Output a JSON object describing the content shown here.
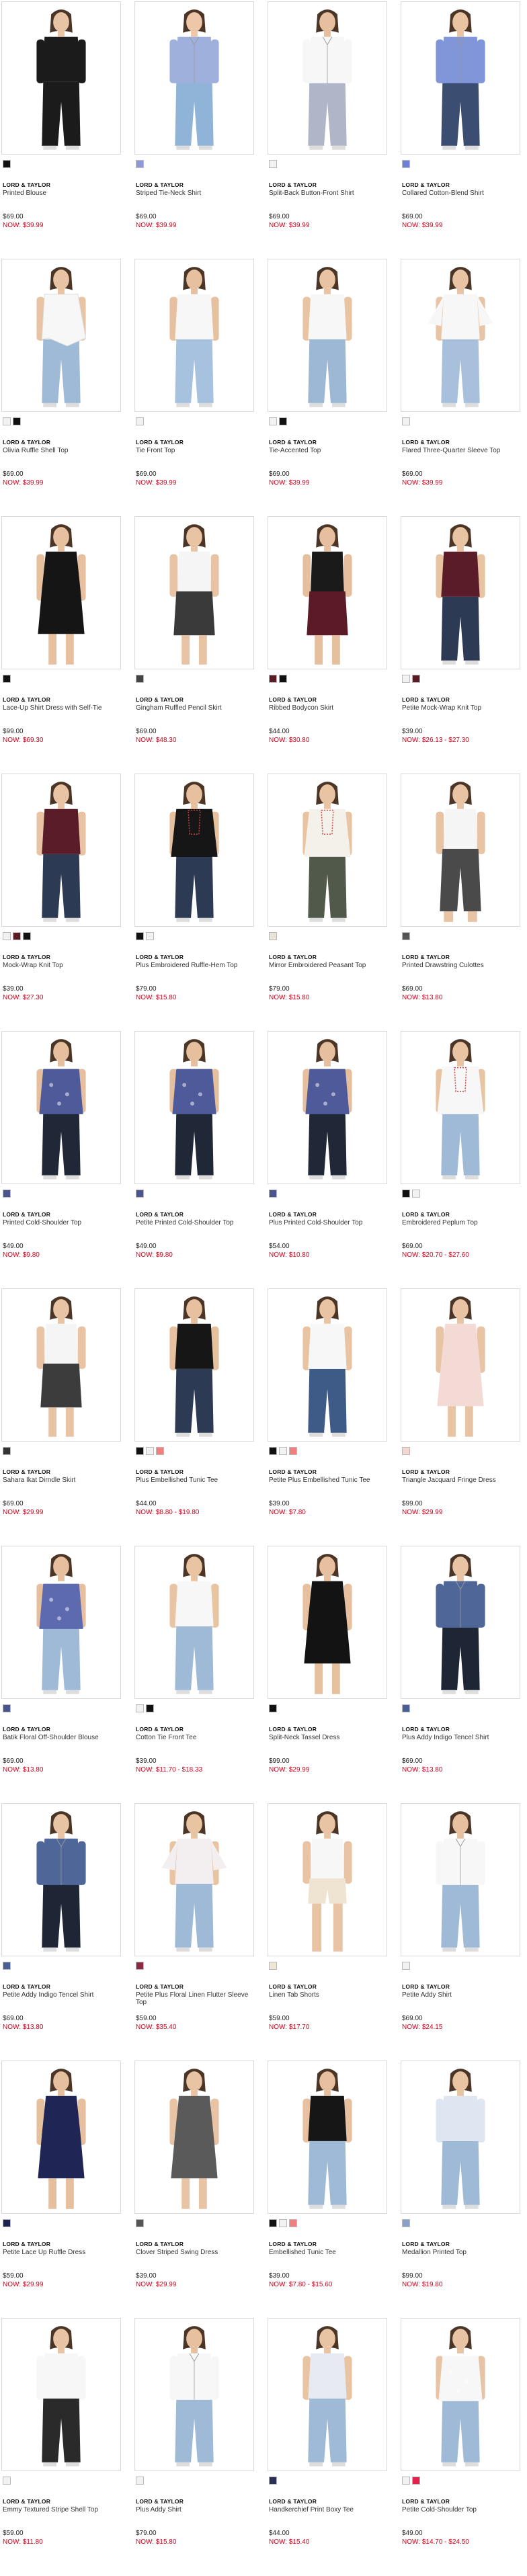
{
  "products": [
    {
      "brand": "LORD & TAYLOR",
      "name": "Printed Blouse",
      "price": "$69.00",
      "sale": "NOW: $39.99",
      "swatches": [
        "#111111"
      ],
      "top": "#1b1b1b",
      "bottom": "#1b1b1b",
      "skin": "#e8c3a4",
      "style": "blouse"
    },
    {
      "brand": "LORD & TAYLOR",
      "name": "Striped Tie-Neck Shirt",
      "price": "$69.00",
      "sale": "NOW: $39.99",
      "swatches": [
        "#8e9ad8"
      ],
      "top": "#9fb0dc",
      "bottom": "#8fb4d8",
      "skin": "#edc7a8",
      "style": "shirt"
    },
    {
      "brand": "LORD & TAYLOR",
      "name": "Split-Back Button-Front Shirt",
      "price": "$69.00",
      "sale": "NOW: $39.99",
      "swatches": [
        "#f2f2f2"
      ],
      "top": "#f7f7f7",
      "bottom": "#aeb6c8",
      "skin": "#e5bf9e",
      "style": "shirt"
    },
    {
      "brand": "LORD & TAYLOR",
      "name": "Collared Cotton-Blend Shirt",
      "price": "$69.00",
      "sale": "NOW: $39.99",
      "swatches": [
        "#6f7fd6"
      ],
      "top": "#8196d8",
      "bottom": "#3b4d70",
      "skin": "#e9c4a2",
      "style": "shirt"
    },
    {
      "brand": "LORD & TAYLOR",
      "name": "Olivia Ruffle Shell Top",
      "price": "$69.00",
      "sale": "NOW: $39.99",
      "swatches": [
        "#f2f2f2",
        "#111111"
      ],
      "top": "#f7f7f7",
      "bottom": "#9fbad6",
      "skin": "#e8c3a4",
      "style": "ruffle"
    },
    {
      "brand": "LORD & TAYLOR",
      "name": "Tie Front Top",
      "price": "$69.00",
      "sale": "NOW: $39.99",
      "swatches": [
        "#f2f2f2"
      ],
      "top": "#f7f7f7",
      "bottom": "#a7c2de",
      "skin": "#e6c09f",
      "style": "tee"
    },
    {
      "brand": "LORD & TAYLOR",
      "name": "Tie-Accented Top",
      "price": "$69.00",
      "sale": "NOW: $39.99",
      "swatches": [
        "#f2f2f2",
        "#111111"
      ],
      "top": "#f7f7f7",
      "bottom": "#9db8d4",
      "skin": "#e9c4a2",
      "style": "tee"
    },
    {
      "brand": "LORD & TAYLOR",
      "name": "Flared Three-Quarter Sleeve Top",
      "price": "$69.00",
      "sale": "NOW: $39.99",
      "swatches": [
        "#f2f2f2"
      ],
      "top": "#f7f7f7",
      "bottom": "#a8c0dc",
      "skin": "#e8c3a4",
      "style": "flare"
    },
    {
      "brand": "LORD & TAYLOR",
      "name": "Lace-Up Shirt Dress with Self-Tie",
      "price": "$99.00",
      "sale": "NOW: $69.30",
      "swatches": [
        "#111111"
      ],
      "top": "#151515",
      "bottom": "#151515",
      "skin": "#e6c09f",
      "style": "dress"
    },
    {
      "brand": "LORD & TAYLOR",
      "name": "Gingham Ruffled Pencil Skirt",
      "price": "$69.00",
      "sale": "NOW: $48.30",
      "swatches": [
        "#444444"
      ],
      "top": "#f5f5f5",
      "bottom": "#3a3a3a",
      "skin": "#e8c3a4",
      "style": "skirt"
    },
    {
      "brand": "LORD & TAYLOR",
      "name": "Ribbed Bodycon Skirt",
      "price": "$44.00",
      "sale": "NOW: $30.80",
      "swatches": [
        "#5a1a24",
        "#111111"
      ],
      "top": "#1a1a1a",
      "bottom": "#5a1a26",
      "skin": "#e5bf9e",
      "style": "skirt"
    },
    {
      "brand": "LORD & TAYLOR",
      "name": "Petite Mock-Wrap Knit Top",
      "price": "$39.00",
      "sale": "NOW: $26.13 - $27.30",
      "swatches": [
        "#f2f2f2",
        "#5a1a24"
      ],
      "top": "#5a1c28",
      "bottom": "#2d3a54",
      "skin": "#e9c4a2",
      "style": "tee"
    },
    {
      "brand": "LORD & TAYLOR",
      "name": "Mock-Wrap Knit Top",
      "price": "$39.00",
      "sale": "NOW: $27.30",
      "swatches": [
        "#f2f2f2",
        "#5a1a24",
        "#111111"
      ],
      "top": "#5a1c28",
      "bottom": "#2d3a54",
      "skin": "#e8c3a4",
      "style": "tee"
    },
    {
      "brand": "LORD & TAYLOR",
      "name": "Plus Embroidered Ruffle-Hem Top",
      "price": "$79.00",
      "sale": "NOW: $15.80",
      "swatches": [
        "#111111",
        "#f2f2f2"
      ],
      "top": "#161616",
      "bottom": "#2d3a54",
      "skin": "#e6c09f",
      "style": "peasant"
    },
    {
      "brand": "LORD & TAYLOR",
      "name": "Mirror Embroidered Peasant Top",
      "price": "$79.00",
      "sale": "NOW: $15.80",
      "swatches": [
        "#e9e4da"
      ],
      "top": "#f4f1ea",
      "bottom": "#51594a",
      "skin": "#e9c4a2",
      "style": "peasant"
    },
    {
      "brand": "LORD & TAYLOR",
      "name": "Printed Drawstring Culottes",
      "price": "$69.00",
      "sale": "NOW: $13.80",
      "swatches": [
        "#555555"
      ],
      "top": "#f5f5f5",
      "bottom": "#4a4a4a",
      "skin": "#e8c3a4",
      "style": "pants"
    },
    {
      "brand": "LORD & TAYLOR",
      "name": "Printed Cold-Shoulder Top",
      "price": "$49.00",
      "sale": "NOW: $9.80",
      "swatches": [
        "#4a5590"
      ],
      "top": "#4f5a9a",
      "bottom": "#202838",
      "skin": "#e5bf9e",
      "style": "coldshoulder"
    },
    {
      "brand": "LORD & TAYLOR",
      "name": "Petite Printed Cold-Shoulder Top",
      "price": "$49.00",
      "sale": "NOW: $9.80",
      "swatches": [
        "#4a5590"
      ],
      "top": "#4f5a9a",
      "bottom": "#202838",
      "skin": "#e5bf9e",
      "style": "coldshoulder"
    },
    {
      "brand": "LORD & TAYLOR",
      "name": "Plus Printed Cold-Shoulder Top",
      "price": "$54.00",
      "sale": "NOW: $10.80",
      "swatches": [
        "#4a5590"
      ],
      "top": "#4f5a9a",
      "bottom": "#202838",
      "skin": "#e5bf9e",
      "style": "coldshoulder"
    },
    {
      "brand": "LORD & TAYLOR",
      "name": "Embroidered Peplum Top",
      "price": "$69.00",
      "sale": "NOW: $20.70 - $27.60",
      "swatches": [
        "#111111",
        "#f2f2f2"
      ],
      "top": "#f7f7f7",
      "bottom": "#9fbad6",
      "skin": "#e9c4a2",
      "style": "peasant"
    },
    {
      "brand": "LORD & TAYLOR",
      "name": "Sahara Ikat Dirndle Skirt",
      "price": "$69.00",
      "sale": "NOW: $29.99",
      "swatches": [
        "#333333"
      ],
      "top": "#f5f5f5",
      "bottom": "#3c3c3c",
      "skin": "#e8c3a4",
      "style": "skirt"
    },
    {
      "brand": "LORD & TAYLOR",
      "name": "Plus Embellished Tunic Tee",
      "price": "$44.00",
      "sale": "NOW: $8.80 - $19.80",
      "swatches": [
        "#111111",
        "#f2f2f2",
        "#f08080"
      ],
      "top": "#161616",
      "bottom": "#2d3a54",
      "skin": "#e6c09f",
      "style": "tee"
    },
    {
      "brand": "LORD & TAYLOR",
      "name": "Petite Plus Embellished Tunic Tee",
      "price": "$39.00",
      "sale": "NOW: $7.80",
      "swatches": [
        "#111111",
        "#f2f2f2",
        "#f08080"
      ],
      "top": "#f7f7f7",
      "bottom": "#3e5a86",
      "skin": "#e9c4a2",
      "style": "tee"
    },
    {
      "brand": "LORD & TAYLOR",
      "name": "Triangle Jacquard Fringe Dress",
      "price": "$99.00",
      "sale": "NOW: $29.99",
      "swatches": [
        "#f2d8d0"
      ],
      "top": "#f3dad5",
      "bottom": "#f3dad5",
      "skin": "#e8c3a4",
      "style": "dress"
    },
    {
      "brand": "LORD & TAYLOR",
      "name": "Batik Floral Off-Shoulder Blouse",
      "price": "$69.00",
      "sale": "NOW: $13.80",
      "swatches": [
        "#4a5590"
      ],
      "top": "#5d6ab0",
      "bottom": "#9fbad6",
      "skin": "#e5bf9e",
      "style": "coldshoulder"
    },
    {
      "brand": "LORD & TAYLOR",
      "name": "Cotton Tie Front Tee",
      "price": "$39.00",
      "sale": "NOW: $11.70 - $18.33",
      "swatches": [
        "#f2f2f2",
        "#111111"
      ],
      "top": "#f7f7f7",
      "bottom": "#9fbad6",
      "skin": "#e9c4a2",
      "style": "tee"
    },
    {
      "brand": "LORD & TAYLOR",
      "name": "Split-Neck Tassel Dress",
      "price": "$99.00",
      "sale": "NOW: $29.99",
      "swatches": [
        "#111111"
      ],
      "top": "#131313",
      "bottom": "#131313",
      "skin": "#e6c09f",
      "style": "dress"
    },
    {
      "brand": "LORD & TAYLOR",
      "name": "Plus Addy Indigo Tencel Shirt",
      "price": "$69.00",
      "sale": "NOW: $13.80",
      "swatches": [
        "#4a5f95"
      ],
      "top": "#4e6798",
      "bottom": "#1e2636",
      "skin": "#e8c3a4",
      "style": "shirt"
    },
    {
      "brand": "LORD & TAYLOR",
      "name": "Petite Addy Indigo Tencel Shirt",
      "price": "$69.00",
      "sale": "NOW: $13.80",
      "swatches": [
        "#4a5f95"
      ],
      "top": "#4e6798",
      "bottom": "#1e2636",
      "skin": "#e8c3a4",
      "style": "shirt"
    },
    {
      "brand": "LORD & TAYLOR",
      "name": "Petite Plus Floral Linen Flutter Sleeve Top",
      "price": "$59.00",
      "sale": "NOW: $35.40",
      "swatches": [
        "#8a2a40"
      ],
      "top": "#f3eef0",
      "bottom": "#9fbad6",
      "skin": "#e9c4a2",
      "style": "flare"
    },
    {
      "brand": "LORD & TAYLOR",
      "name": "Linen Tab Shorts",
      "price": "$59.00",
      "sale": "NOW: $17.70",
      "swatches": [
        "#efe6d6"
      ],
      "top": "#f7f7f7",
      "bottom": "#efe4d2",
      "skin": "#e8c3a4",
      "style": "shorts"
    },
    {
      "brand": "LORD & TAYLOR",
      "name": "Petite Addy Shirt",
      "price": "$69.00",
      "sale": "NOW: $24.15",
      "swatches": [
        "#f2f2f2"
      ],
      "top": "#f7f7f7",
      "bottom": "#9fbad6",
      "skin": "#e6c09f",
      "style": "shirt"
    },
    {
      "brand": "LORD & TAYLOR",
      "name": "Petite Lace Up Ruffle Dress",
      "price": "$59.00",
      "sale": "NOW: $29.99",
      "swatches": [
        "#1d2350"
      ],
      "top": "#1f2656",
      "bottom": "#1f2656",
      "skin": "#e5bf9e",
      "style": "dress"
    },
    {
      "brand": "LORD & TAYLOR",
      "name": "Clover Striped Swing Dress",
      "price": "$39.00",
      "sale": "NOW: $29.99",
      "swatches": [
        "#555555"
      ],
      "top": "#5a5a5a",
      "bottom": "#5a5a5a",
      "skin": "#e8c3a4",
      "style": "dress"
    },
    {
      "brand": "LORD & TAYLOR",
      "name": "Embellished Tunic Tee",
      "price": "$39.00",
      "sale": "NOW: $7.80 - $15.60",
      "swatches": [
        "#111111",
        "#f2f2f2",
        "#f08080"
      ],
      "top": "#161616",
      "bottom": "#9fbad6",
      "skin": "#e6c09f",
      "style": "tee"
    },
    {
      "brand": "LORD & TAYLOR",
      "name": "Medallion Printed Top",
      "price": "$99.00",
      "sale": "NOW: $19.80",
      "swatches": [
        "#8aa0c8"
      ],
      "top": "#dfe6f1",
      "bottom": "#9fbad6",
      "skin": "#e9c4a2",
      "style": "blouse"
    },
    {
      "brand": "LORD & TAYLOR",
      "name": "Emmy Textured Stripe Shell Top",
      "price": "$59.00",
      "sale": "NOW: $11.80",
      "swatches": [
        "#f2f2f2"
      ],
      "top": "#f7f7f7",
      "bottom": "#2a2a2a",
      "skin": "#e8c3a4",
      "style": "blouse"
    },
    {
      "brand": "LORD & TAYLOR",
      "name": "Plus Addy Shirt",
      "price": "$79.00",
      "sale": "NOW: $15.80",
      "swatches": [
        "#f2f2f2"
      ],
      "top": "#f7f7f7",
      "bottom": "#9fbad6",
      "skin": "#e6c09f",
      "style": "shirt"
    },
    {
      "brand": "LORD & TAYLOR",
      "name": "Handkerchief Print Boxy Tee",
      "price": "$44.00",
      "sale": "NOW: $15.40",
      "swatches": [
        "#2a2f55"
      ],
      "top": "#e8eaf2",
      "bottom": "#9fbad6",
      "skin": "#e9c4a2",
      "style": "tee"
    },
    {
      "brand": "LORD & TAYLOR",
      "name": "Petite Cold-Shoulder Top",
      "price": "$49.00",
      "sale": "NOW: $14.70 - $24.50",
      "swatches": [
        "#f2f2f2",
        "#e2214d"
      ],
      "top": "#f7f7f7",
      "bottom": "#9fbad6",
      "skin": "#e8c3a4",
      "style": "coldshoulder"
    }
  ]
}
